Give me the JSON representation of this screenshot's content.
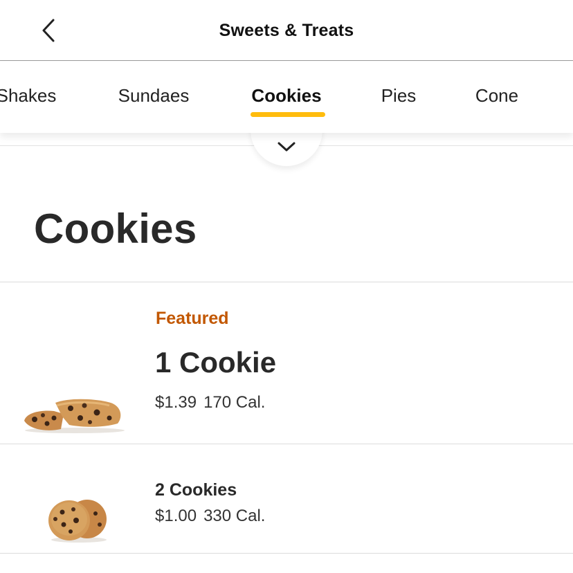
{
  "header": {
    "title": "Sweets & Treats",
    "back_icon": "chevron-left-icon"
  },
  "tabs": [
    {
      "label": "Shakes",
      "active": false
    },
    {
      "label": "Sundaes",
      "active": false
    },
    {
      "label": "Cookies",
      "active": true
    },
    {
      "label": "Pies",
      "active": false
    },
    {
      "label": "Cone",
      "active": false
    }
  ],
  "expand_icon": "chevron-down-icon",
  "section": {
    "title": "Cookies"
  },
  "items": [
    {
      "badge": "Featured",
      "name": "1 Cookie",
      "price": "$1.39",
      "calories": "170 Cal.",
      "image": "broken-cookie-image"
    },
    {
      "name": "2 Cookies",
      "price": "$1.00",
      "calories": "330 Cal.",
      "image": "two-cookies-image"
    }
  ],
  "colors": {
    "accent": "#ffbc0d",
    "featured": "#c25700",
    "text": "#292929"
  }
}
